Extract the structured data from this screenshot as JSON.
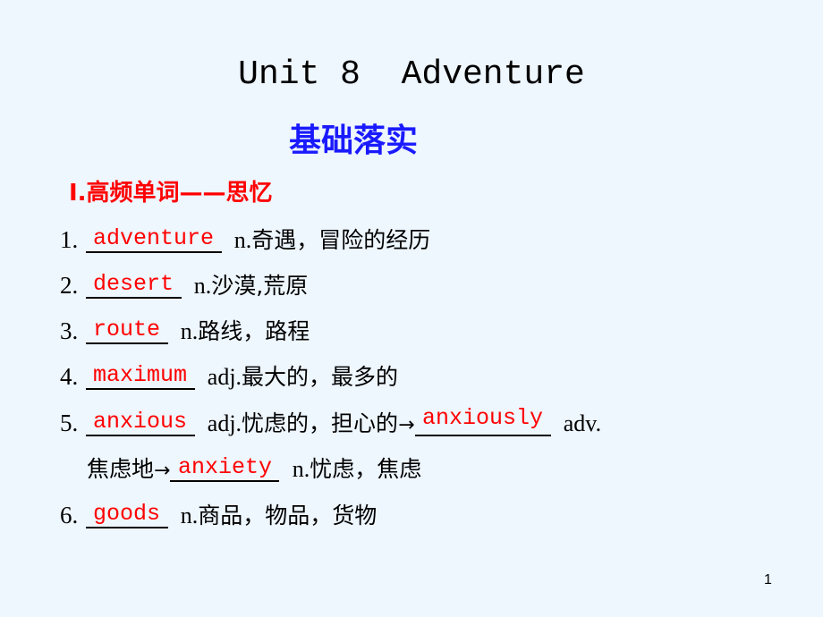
{
  "title": "Unit 8  Adventure",
  "subtitle": "基础落实",
  "section_heading": "Ⅰ.高频单词——思忆",
  "items": [
    {
      "num": "1.",
      "answer": "adventure",
      "pos": "n.",
      "meaning": "奇遇，冒险的经历"
    },
    {
      "num": "2.",
      "answer": "desert",
      "pos": "n.",
      "meaning": "沙漠,荒原"
    },
    {
      "num": "3.",
      "answer": "route",
      "pos": "n.",
      "meaning": "路线，路程"
    },
    {
      "num": "4.",
      "answer": "maximum",
      "pos": "adj.",
      "meaning": "最大的，最多的"
    },
    {
      "num": "5.",
      "answer": "anxious",
      "pos": "adj.",
      "meaning": "忧虑的，担心的",
      "arrow": "→",
      "answer2": "anxiously",
      "pos2": "adv."
    },
    {
      "cont_meaning": "焦虑地",
      "arrow": "→",
      "answer": "anxiety",
      "pos": "n.",
      "meaning": "忧虑，焦虑"
    },
    {
      "num": "6.",
      "answer": "goods",
      "pos": "n.",
      "meaning": "商品，物品，货物"
    }
  ],
  "page_number": "1"
}
